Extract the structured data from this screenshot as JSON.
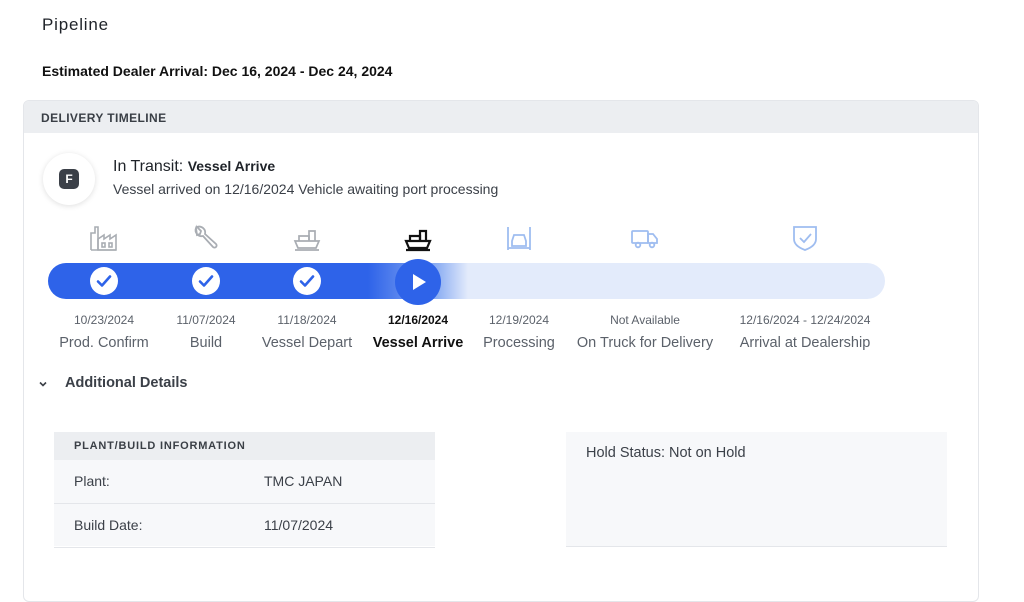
{
  "page": {
    "title": "Pipeline",
    "arrival_text": "Estimated Dealer Arrival: Dec 16, 2024 - Dec 24, 2024"
  },
  "timeline": {
    "header": "DELIVERY TIMELINE",
    "badge_letter": "F",
    "status_main": "In Transit:",
    "status_sub": "Vessel Arrive",
    "status_desc": "Vessel arrived on 12/16/2024 Vehicle awaiting port processing",
    "stages": [
      {
        "date": "10/23/2024",
        "label": "Prod. Confirm",
        "state": "complete",
        "icon": "factory-icon"
      },
      {
        "date": "11/07/2024",
        "label": "Build",
        "state": "complete",
        "icon": "wrench-icon"
      },
      {
        "date": "11/18/2024",
        "label": "Vessel Depart",
        "state": "complete",
        "icon": "ship-icon"
      },
      {
        "date": "12/16/2024",
        "label": "Vessel Arrive",
        "state": "current",
        "icon": "ship-icon"
      },
      {
        "date": "12/19/2024",
        "label": "Processing",
        "state": "upcoming",
        "icon": "car-lift-icon"
      },
      {
        "date": "Not Available",
        "label": "On Truck for Delivery",
        "state": "upcoming",
        "icon": "truck-icon"
      },
      {
        "date": "12/16/2024 - 12/24/2024",
        "label": "Arrival at Dealership",
        "state": "upcoming",
        "icon": "shield-check-icon"
      }
    ]
  },
  "details": {
    "toggle_label": "Additional Details",
    "plant_header": "PLANT/BUILD INFORMATION",
    "rows": [
      {
        "key": "Plant:",
        "value": "TMC JAPAN"
      },
      {
        "key": "Build Date:",
        "value": "11/07/2024"
      }
    ],
    "hold_status": "Hold Status: Not on Hold"
  },
  "colors": {
    "accent": "#2e63e9",
    "track_bg": "#e3ebfb",
    "muted_icon": "#a9adb3",
    "upcoming_icon": "#9fbdf0"
  }
}
